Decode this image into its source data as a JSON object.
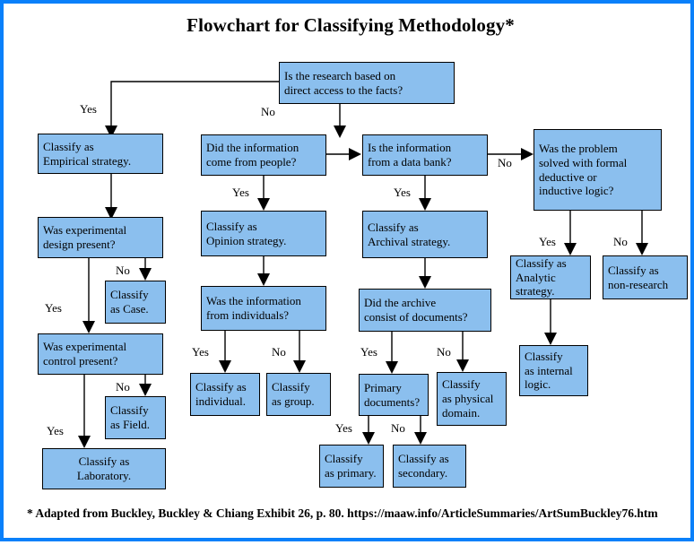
{
  "title": "Flowchart for Classifying Methodology*",
  "footer": "* Adapted from Buckley, Buckley & Chiang Exhibit 26, p. 80. https://maaw.info/ArticleSummaries/ArtSumBuckley76.htm",
  "colors": {
    "frame_border": "#0a80fa",
    "node_fill": "#8bbfee",
    "node_border": "#000000",
    "connector": "#000000",
    "background": "#ffffff",
    "text": "#000000"
  },
  "chart_data": {
    "type": "diagram",
    "diagram_kind": "flowchart",
    "title": "Flowchart for Classifying Methodology*",
    "nodes": [
      {
        "id": "root",
        "label": "Is the research  based on\ndirect  access to the facts?"
      },
      {
        "id": "empirical",
        "label": "Classify as\n Empirical strategy."
      },
      {
        "id": "expdesign",
        "label": "Was experimental\ndesign present?"
      },
      {
        "id": "case",
        "label": "Classify\nas Case."
      },
      {
        "id": "expcontrol",
        "label": "Was experimental\ncontrol present?"
      },
      {
        "id": "field",
        "label": "Classify\nas Field."
      },
      {
        "id": "laboratory",
        "label": "Classify as\nLaboratory."
      },
      {
        "id": "people",
        "label": "Did the information\ncome from people?"
      },
      {
        "id": "opinion",
        "label": "Classify as\n Opinion  strategy."
      },
      {
        "id": "individuals",
        "label": "Was the information\nfrom individuals?"
      },
      {
        "id": "individual",
        "label": "Classify as\nindividual."
      },
      {
        "id": "group",
        "label": "Classify\nas group."
      },
      {
        "id": "databank",
        "label": "Is the information\nfrom a data bank?"
      },
      {
        "id": "archival",
        "label": "Classify as\nArchival strategy."
      },
      {
        "id": "archive",
        "label": "Did the archive\nconsist of documents?"
      },
      {
        "id": "primarydocs",
        "label": "Primary\ndocuments?"
      },
      {
        "id": "physical",
        "label": "Classify\nas physical\ndomain."
      },
      {
        "id": "primary",
        "label": "Classify\nas primary."
      },
      {
        "id": "secondary",
        "label": "Classify as\nsecondary."
      },
      {
        "id": "problem",
        "label": "Was the problem\nsolved with formal\ndeductive or\ninductive logic?"
      },
      {
        "id": "analytic",
        "label": "Classify as\nAnalytic\nstrategy."
      },
      {
        "id": "nonresearch",
        "label": "Classify as\nnon-research"
      },
      {
        "id": "internal",
        "label": "Classify\nas internal\nlogic."
      }
    ],
    "edges": [
      {
        "from": "root",
        "to": "empirical",
        "label": "Yes"
      },
      {
        "from": "root",
        "to": "people",
        "label": "No"
      },
      {
        "from": "empirical",
        "to": "expdesign",
        "label": ""
      },
      {
        "from": "expdesign",
        "to": "case",
        "label": "No"
      },
      {
        "from": "expdesign",
        "to": "expcontrol",
        "label": "Yes"
      },
      {
        "from": "expcontrol",
        "to": "field",
        "label": "No"
      },
      {
        "from": "expcontrol",
        "to": "laboratory",
        "label": "Yes"
      },
      {
        "from": "people",
        "to": "opinion",
        "label": "Yes"
      },
      {
        "from": "people",
        "to": "databank",
        "label": ""
      },
      {
        "from": "opinion",
        "to": "individuals",
        "label": ""
      },
      {
        "from": "individuals",
        "to": "individual",
        "label": "Yes"
      },
      {
        "from": "individuals",
        "to": "group",
        "label": "No"
      },
      {
        "from": "databank",
        "to": "archival",
        "label": "Yes"
      },
      {
        "from": "databank",
        "to": "problem",
        "label": "No"
      },
      {
        "from": "archival",
        "to": "archive",
        "label": ""
      },
      {
        "from": "archive",
        "to": "primarydocs",
        "label": "Yes"
      },
      {
        "from": "archive",
        "to": "physical",
        "label": "No"
      },
      {
        "from": "primarydocs",
        "to": "primary",
        "label": "Yes"
      },
      {
        "from": "primarydocs",
        "to": "secondary",
        "label": "No"
      },
      {
        "from": "problem",
        "to": "analytic",
        "label": "Yes"
      },
      {
        "from": "problem",
        "to": "nonresearch",
        "label": "No"
      },
      {
        "from": "analytic",
        "to": "internal",
        "label": ""
      }
    ],
    "edge_labels": [
      "Yes",
      "No",
      "No",
      "Yes",
      "No",
      "Yes",
      "Yes",
      "Yes",
      "No",
      "Yes",
      "No",
      "Yes",
      "No",
      "Yes",
      "No",
      "Yes",
      "No"
    ]
  },
  "nodes": {
    "root": "Is the research  based on\ndirect  access to the facts?",
    "empirical": "Classify as\n Empirical strategy.",
    "expdesign": "Was experimental\ndesign present?",
    "case": "Classify\nas Case.",
    "expcontrol": "Was experimental\ncontrol present?",
    "field": "Classify\nas Field.",
    "laboratory": "Classify as\nLaboratory.",
    "people": "Did the information\ncome from people?",
    "opinion": "Classify as\n Opinion  strategy.",
    "individuals": "Was the information\nfrom individuals?",
    "individual": "Classify as\nindividual.",
    "group": "Classify\nas group.",
    "databank": "Is the information\nfrom a data bank?",
    "archival": "Classify as\nArchival strategy.",
    "archive": "Did the archive\nconsist of documents?",
    "primarydocs": "Primary\ndocuments?",
    "physical": "Classify\nas physical\ndomain.",
    "primary": "Classify\nas primary.",
    "secondary": "Classify as\nsecondary.",
    "problem": "Was the problem\nsolved with formal\ndeductive or\ninductive logic?",
    "analytic": "Classify as\nAnalytic\nstrategy.",
    "nonresearch": "Classify as\nnon-research",
    "internal": "Classify\nas internal\nlogic."
  },
  "labels": {
    "root_yes": "Yes",
    "root_no": "No",
    "expdesign_no": "No",
    "expdesign_yes": "Yes",
    "expcontrol_no": "No",
    "expcontrol_yes": "Yes",
    "people_yes": "Yes",
    "individuals_yes": "Yes",
    "individuals_no": "No",
    "databank_yes": "Yes",
    "databank_no": "No",
    "archive_yes": "Yes",
    "archive_no": "No",
    "primarydocs_yes": "Yes",
    "primarydocs_no": "No",
    "problem_yes": "Yes",
    "problem_no": "No"
  }
}
